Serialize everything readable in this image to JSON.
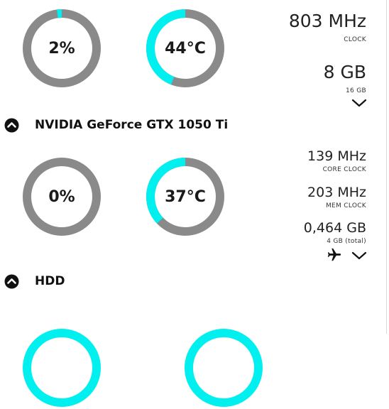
{
  "colors": {
    "accent": "#00f0f0",
    "track": "#8a8a8a"
  },
  "cpu": {
    "load": {
      "text": "2%",
      "fraction": 0.02
    },
    "temp": {
      "text": "44°C",
      "fraction": 0.44
    },
    "clock_value": "803 MHz",
    "clock_label": "CLOCK",
    "ram_value": "8 GB",
    "ram_total": "16 GB",
    "expand_icon": "chevron-down-icon"
  },
  "gpu": {
    "title": "NVIDIA GeForce GTX 1050 Ti",
    "collapse_icon": "chevron-up-circle-icon",
    "load": {
      "text": "0%",
      "fraction": 0.0
    },
    "temp": {
      "text": "37°C",
      "fraction": 0.37
    },
    "core_clock_value": "139 MHz",
    "core_clock_label": "CORE CLOCK",
    "mem_clock_value": "203 MHz",
    "mem_clock_label": "MEM CLOCK",
    "vram_value": "0,464 GB",
    "vram_total": "4 GB (total)",
    "mode_icon": "airplane-icon",
    "expand_icon": "chevron-down-icon"
  },
  "hdd": {
    "title": "HDD",
    "collapse_icon": "chevron-up-circle-icon"
  }
}
